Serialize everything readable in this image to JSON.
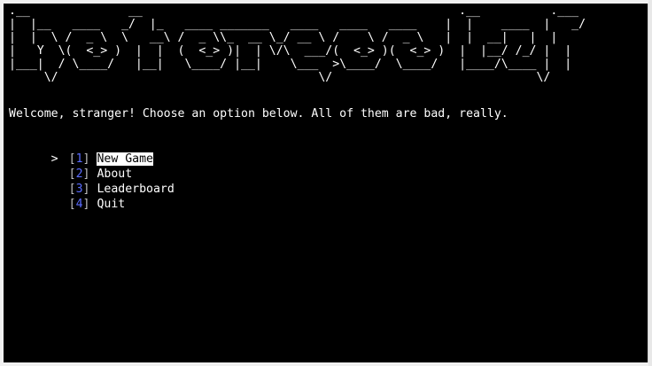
{
  "banner": {
    "lines": [
      ".__              __                                             .__          .___",
      "|  |__   ____   _/  |_   ____ _______   ____   ____   ____    |  |    ____  |   _/",
      "|  |  \\ /  _ \\  \\   __\\ /  _ \\\\_  __ \\_/ __ \\ /    \\ /  _ \\   |  |  __|   |  |",
      "|   Y  \\(  <_> )  |  |  (  <_> )|  | \\/\\  ___/(  <_> )(  <_> )  |  |__/ /_/ |  |",
      "|___|  / \\____/   |__|   \\____/ |__|    \\___  >\\____/  \\____/   |____/\\____ |  |",
      "     \\/                                     \\/                             \\/"
    ]
  },
  "welcome": "Welcome, stranger! Choose an option below. All of them are bad, really.",
  "menu": {
    "cursor": ">",
    "items": [
      {
        "key": "1",
        "label": "New Game",
        "selected": true
      },
      {
        "key": "2",
        "label": "About",
        "selected": false
      },
      {
        "key": "3",
        "label": "Leaderboard",
        "selected": false
      },
      {
        "key": "4",
        "label": "Quit",
        "selected": false
      }
    ]
  },
  "colors": {
    "background": "#000000",
    "text": "#ffffff",
    "key": "#5a6cff",
    "selection_bg": "#ffffff",
    "selection_fg": "#000000"
  }
}
